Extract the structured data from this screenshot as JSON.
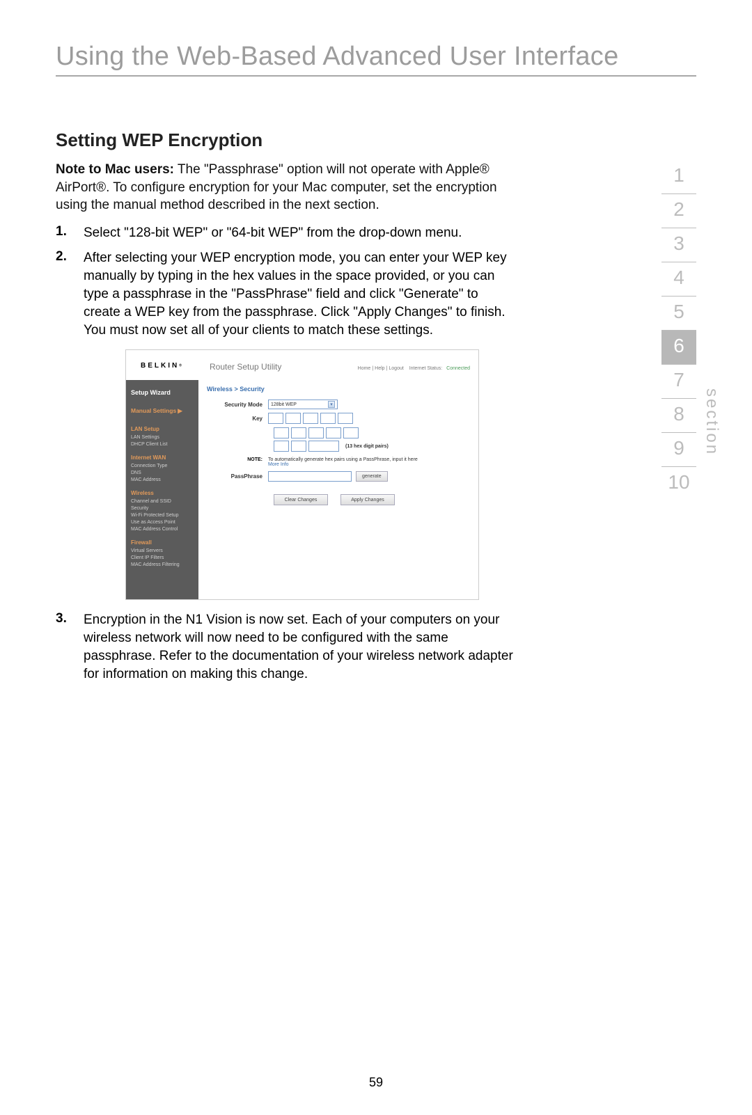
{
  "page": {
    "title": "Using the Web-Based Advanced User Interface",
    "section_heading": "Setting WEP Encryption",
    "note_label": "Note to Mac users:",
    "note_text": " The \"Passphrase\" option will not operate with Apple® AirPort®. To configure encryption for your Mac computer, set the encryption using the manual method described in the next section.",
    "steps": [
      "Select \"128-bit WEP\" or \"64-bit WEP\" from the drop-down menu.",
      "After selecting your WEP encryption mode, you can enter your WEP key manually by typing in the hex values in the space provided, or you can type a passphrase in the \"PassPhrase\" field and click \"Generate\" to create a WEP key from the passphrase. Click \"Apply Changes\" to finish. You must now set all of your clients to match these settings.",
      "Encryption in the N1 Vision is now set. Each of your computers on your wireless network will now need to be configured with the same passphrase. Refer to the documentation of your wireless network adapter for information on making this change."
    ],
    "page_number": "59"
  },
  "section_nav": {
    "numbers": [
      "1",
      "2",
      "3",
      "4",
      "5",
      "6",
      "7",
      "8",
      "9",
      "10"
    ],
    "active": "6",
    "vertical_label": "section"
  },
  "router": {
    "logo": "BELKIN",
    "utility_title": "Router Setup Utility",
    "top_links": {
      "home": "Home",
      "help": "Help",
      "logout": "Logout",
      "status_label": "Internet Status:",
      "status_value": "Connected"
    },
    "breadcrumb": "Wireless > Security",
    "nav": {
      "wizard": "Setup Wizard",
      "manual": "Manual Settings",
      "groups": [
        {
          "header": "LAN Setup",
          "items": [
            "LAN Settings",
            "DHCP Client List"
          ]
        },
        {
          "header": "Internet WAN",
          "items": [
            "Connection Type",
            "DNS",
            "MAC Address"
          ]
        },
        {
          "header": "Wireless",
          "items": [
            "Channel and SSID",
            "Security",
            "Wi-Fi Protected Setup",
            "Use as Access Point",
            "MAC Address Control"
          ]
        },
        {
          "header": "Firewall",
          "items": [
            "Virtual Servers",
            "Client IP Filters",
            "MAC Address Filtering"
          ]
        }
      ]
    },
    "form": {
      "security_mode_label": "Security Mode",
      "security_mode_value": "128bit WEP",
      "key_label": "Key",
      "hex_hint": "(13 hex digit pairs)",
      "note_label": "NOTE:",
      "note_text": "To automatically generate hex pairs using a PassPhrase, input it here",
      "note_link": "More Info",
      "passphrase_label": "PassPhrase",
      "generate_btn": "generate",
      "clear_btn": "Clear Changes",
      "apply_btn": "Apply Changes"
    }
  }
}
